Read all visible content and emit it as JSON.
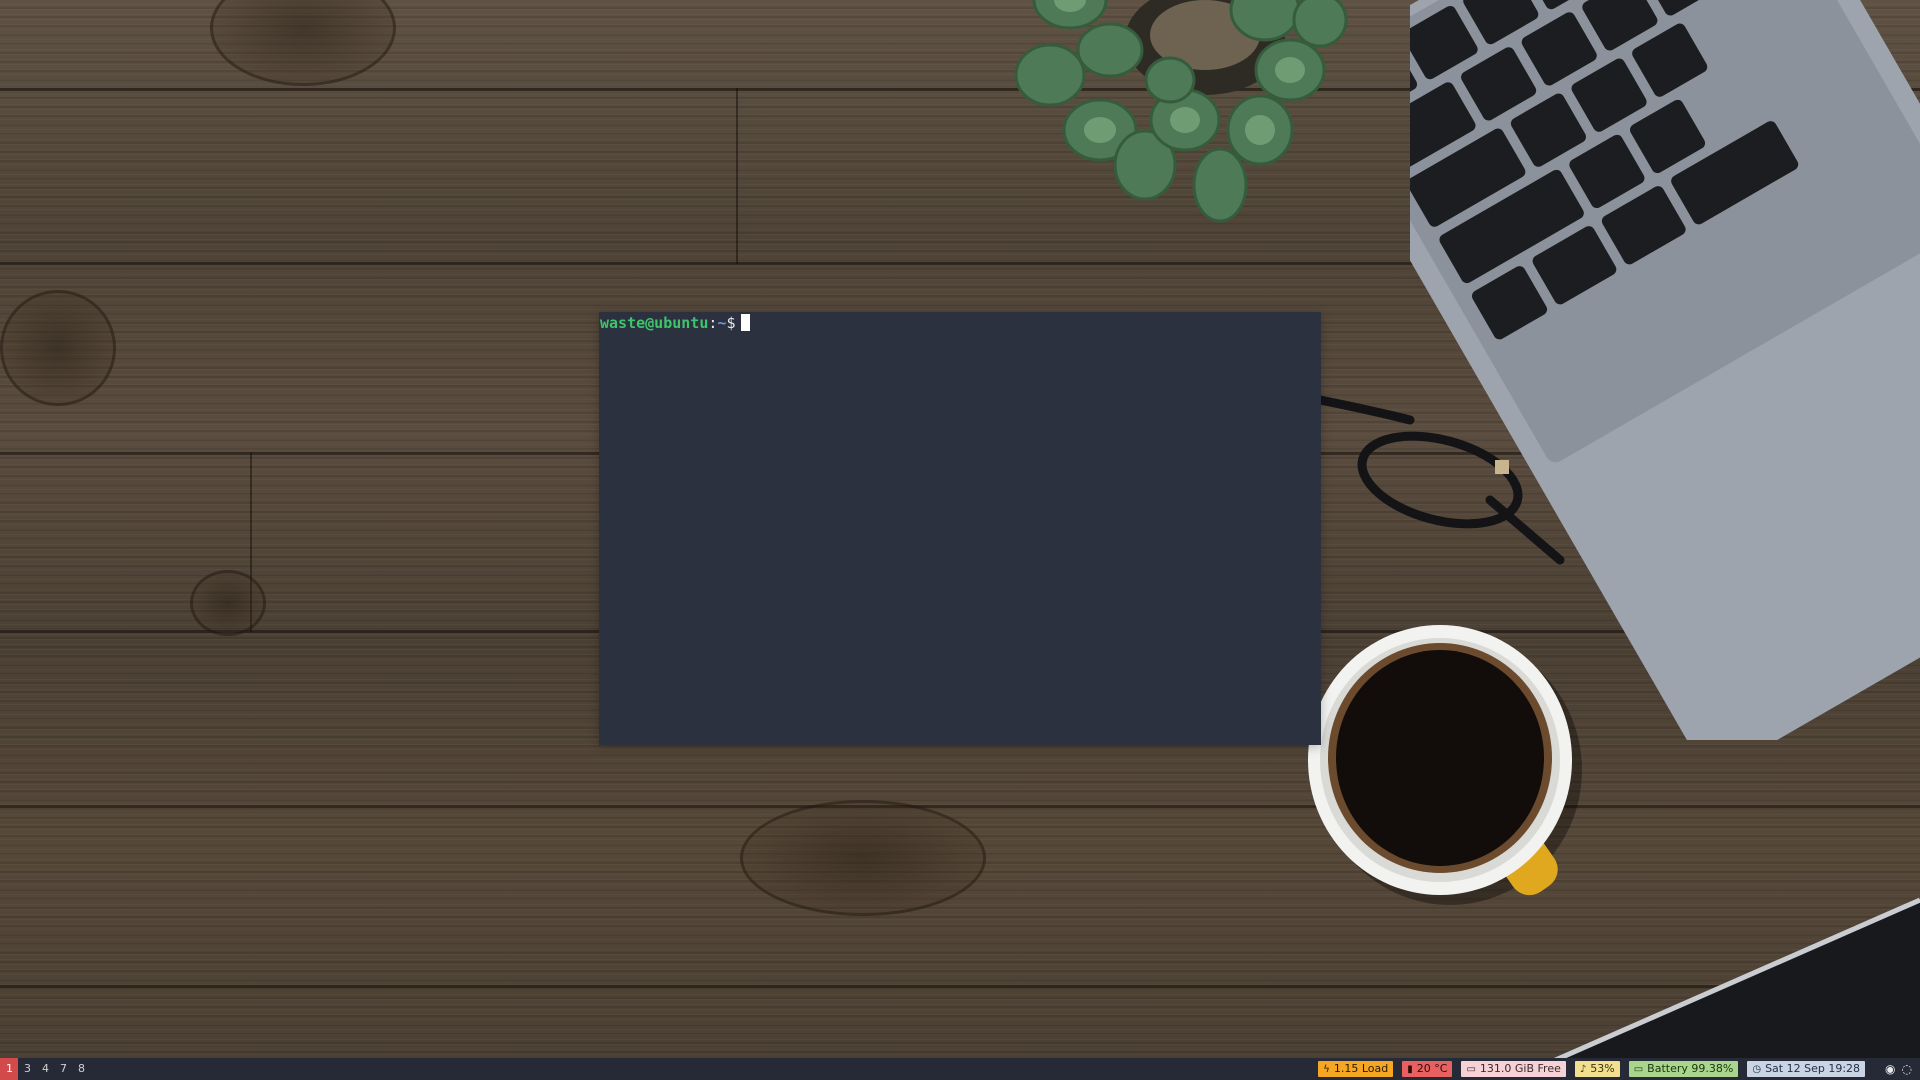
{
  "terminal": {
    "user_host": "waste@ubuntu",
    "separator": ":",
    "path": "~",
    "symbol": "$"
  },
  "statusbar": {
    "workspaces": [
      {
        "label": "1",
        "active": true
      },
      {
        "label": "3",
        "active": false
      },
      {
        "label": "4",
        "active": false
      },
      {
        "label": "7",
        "active": false
      },
      {
        "label": "8",
        "active": false
      }
    ],
    "load": {
      "icon": "load-icon",
      "text": "1.15 Load",
      "color": "#f5a623"
    },
    "temperature": {
      "icon": "thermometer-icon",
      "text": "20 °C",
      "color": "#e86060"
    },
    "disk": {
      "icon": "disk-icon",
      "text": "131.0 GiB Free",
      "color": "#f6d1d6"
    },
    "volume": {
      "icon": "bell-icon",
      "text": "53%",
      "color": "#f3e08f"
    },
    "battery": {
      "icon": "battery-icon",
      "text": "Battery 99.38%",
      "color": "#a9d68c"
    },
    "datetime": {
      "icon": "clock-icon",
      "text": "Sat 12 Sep 19:28",
      "color": "#c9d4e4"
    },
    "tray": [
      {
        "icon": "discord-icon"
      },
      {
        "icon": "network-icon"
      }
    ]
  }
}
